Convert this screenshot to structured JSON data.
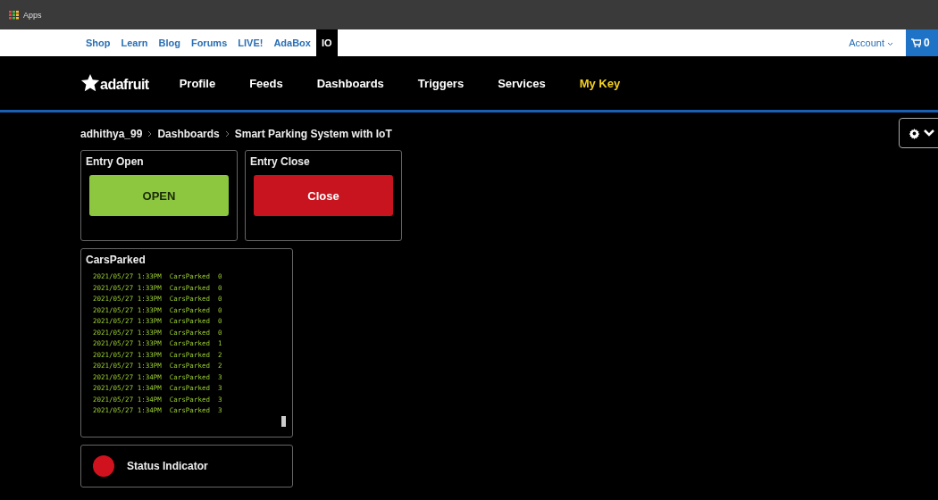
{
  "browser_bar": {
    "apps_label": "Apps"
  },
  "top_links": [
    {
      "label": "Shop",
      "selected": false
    },
    {
      "label": "Learn",
      "selected": false
    },
    {
      "label": "Blog",
      "selected": false
    },
    {
      "label": "Forums",
      "selected": false
    },
    {
      "label": "LIVE!",
      "selected": false
    },
    {
      "label": "AdaBox",
      "selected": false
    },
    {
      "label": "IO",
      "selected": true
    }
  ],
  "account": "Account",
  "cart_count": "0",
  "logo_text": "adafruit",
  "nav": [
    {
      "label": "Profile",
      "selected": false
    },
    {
      "label": "Feeds",
      "selected": false
    },
    {
      "label": "Dashboards",
      "selected": false
    },
    {
      "label": "Triggers",
      "selected": false
    },
    {
      "label": "Services",
      "selected": false
    },
    {
      "label": "My Key",
      "selected": true
    }
  ],
  "breadcrumbs": [
    "adhithya_99",
    "Dashboards",
    "Smart Parking System with IoT"
  ],
  "blocks_row": [
    {
      "title": "Entry Open",
      "button": "OPEN",
      "color": "#8dc63f"
    },
    {
      "title": "Entry Close",
      "button": "Close",
      "color": "#c8141e"
    }
  ],
  "stream": {
    "title": "CarsParked",
    "lines": [
      "2021/05/27 1:33PM  CarsParked  0",
      "2021/05/27 1:33PM  CarsParked  0",
      "2021/05/27 1:33PM  CarsParked  0",
      "2021/05/27 1:33PM  CarsParked  0",
      "2021/05/27 1:33PM  CarsParked  0",
      "2021/05/27 1:33PM  CarsParked  0",
      "2021/05/27 1:33PM  CarsParked  1",
      "2021/05/27 1:33PM  CarsParked  2",
      "2021/05/27 1:33PM  CarsParked  2",
      "2021/05/27 1:34PM  CarsParked  3",
      "2021/05/27 1:34PM  CarsParked  3",
      "2021/05/27 1:34PM  CarsParked  3",
      "2021/05/27 1:34PM  CarsParked  3"
    ]
  },
  "indicator": {
    "label": "Status Indicator",
    "color": "#d0121e"
  }
}
